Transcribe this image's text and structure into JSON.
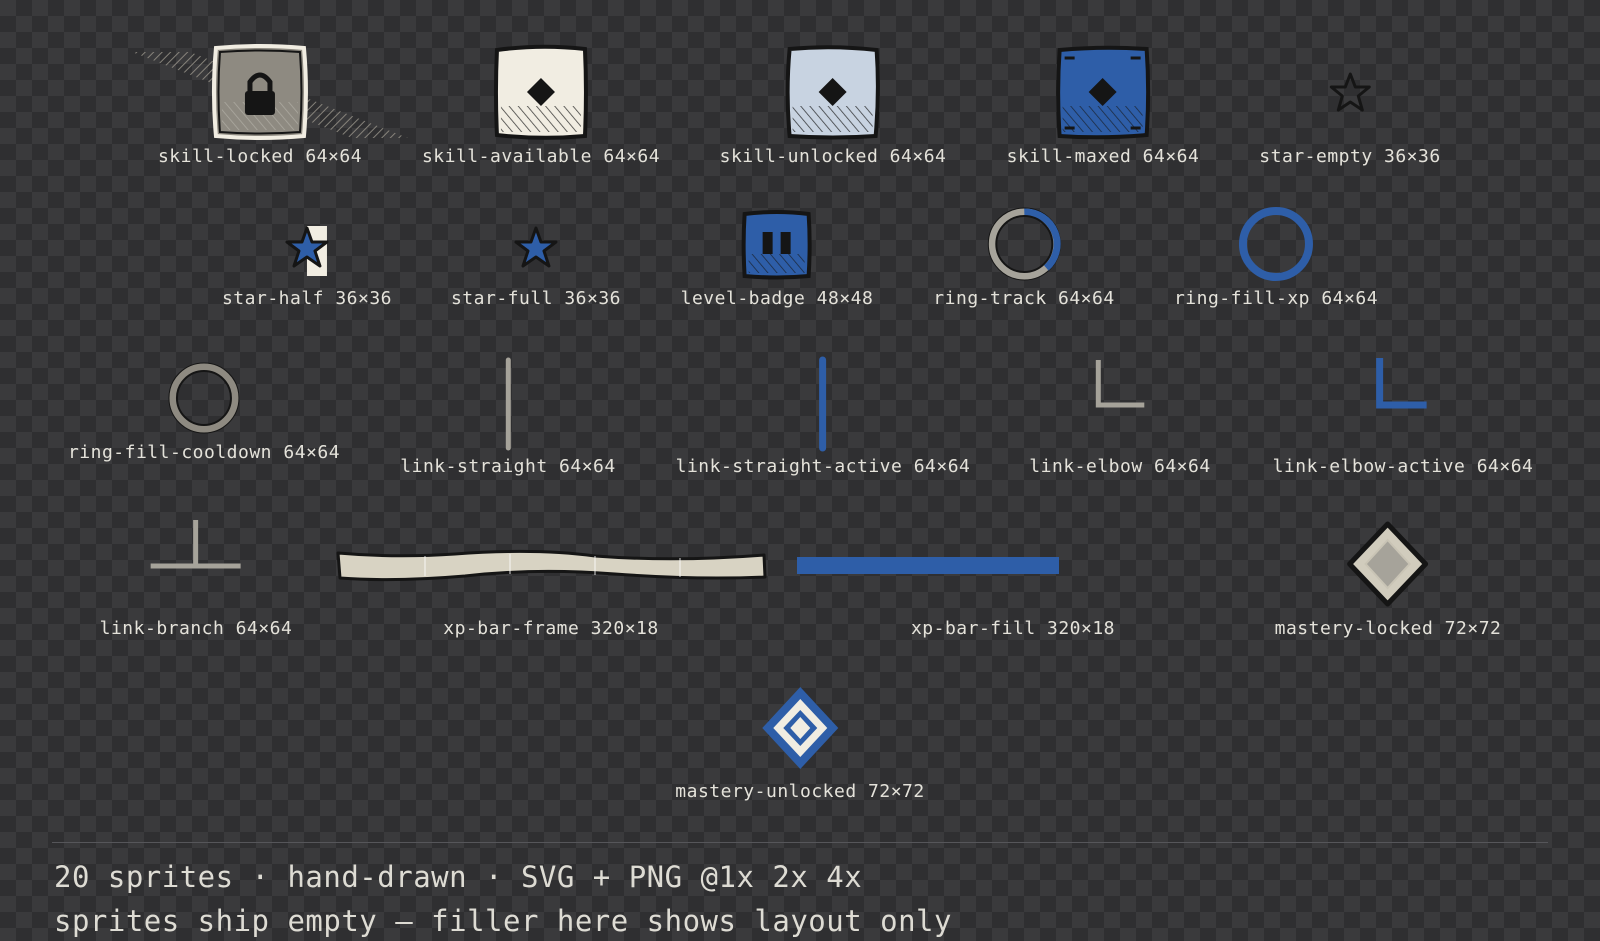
{
  "colors": {
    "accent_blue": "#2e5ea8",
    "paper": "#f1ede2",
    "ink": "#151515",
    "grey": "#a6a39a",
    "locked": "#8e8a81"
  },
  "sprites": [
    {
      "id": "skill-locked",
      "label": "skill-locked 64×64",
      "icon": "padlock-icon"
    },
    {
      "id": "skill-available",
      "label": "skill-available 64×64",
      "icon": "diamond-icon"
    },
    {
      "id": "skill-unlocked",
      "label": "skill-unlocked 64×64",
      "icon": "diamond-icon"
    },
    {
      "id": "skill-maxed",
      "label": "skill-maxed 64×64",
      "icon": "diamond-icon"
    },
    {
      "id": "star-empty",
      "label": "star-empty 36×36",
      "icon": "star-outline-icon"
    },
    {
      "id": "star-half",
      "label": "star-half 36×36",
      "icon": "star-half-icon"
    },
    {
      "id": "star-full",
      "label": "star-full 36×36",
      "icon": "star-filled-icon"
    },
    {
      "id": "level-badge",
      "label": "level-badge 48×48",
      "icon": "badge-icon"
    },
    {
      "id": "ring-track",
      "label": "ring-track 64×64",
      "icon": "ring-icon"
    },
    {
      "id": "ring-fill-xp",
      "label": "ring-fill-xp 64×64",
      "icon": "ring-icon"
    },
    {
      "id": "ring-fill-cooldown",
      "label": "ring-fill-cooldown 64×64",
      "icon": "ring-icon"
    },
    {
      "id": "link-straight",
      "label": "link-straight 64×64",
      "icon": "line-icon"
    },
    {
      "id": "link-straight-active",
      "label": "link-straight-active 64×64",
      "icon": "line-icon"
    },
    {
      "id": "link-elbow",
      "label": "link-elbow 64×64",
      "icon": "elbow-icon"
    },
    {
      "id": "link-elbow-active",
      "label": "link-elbow-active 64×64",
      "icon": "elbow-icon"
    },
    {
      "id": "link-branch",
      "label": "link-branch 64×64",
      "icon": "branch-icon"
    },
    {
      "id": "xp-bar-frame",
      "label": "xp-bar-frame 320×18",
      "icon": "bar-frame-icon"
    },
    {
      "id": "xp-bar-fill",
      "label": "xp-bar-fill 320×18",
      "icon": "bar-fill-icon"
    },
    {
      "id": "mastery-locked",
      "label": "mastery-locked 72×72",
      "icon": "diamond-icon"
    },
    {
      "id": "mastery-unlocked",
      "label": "mastery-unlocked 72×72",
      "icon": "diamond-icon"
    }
  ],
  "footer": {
    "line1": "20 sprites · hand-drawn · SVG + PNG @1x 2x 4x",
    "line2": "sprites ship empty — filler here shows layout only"
  }
}
